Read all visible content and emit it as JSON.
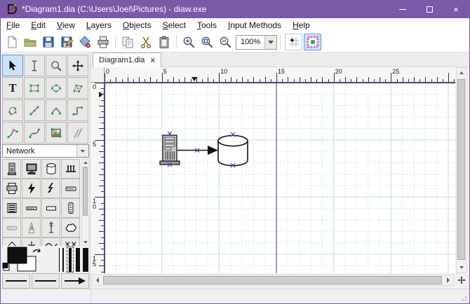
{
  "window": {
    "title": "*Diagram1.dia (C:\\Users\\Joel\\Pictures) - diaw.exe",
    "controls": {
      "close_glyph": "×"
    }
  },
  "menu": {
    "items": [
      "File",
      "Edit",
      "View",
      "Layers",
      "Objects",
      "Select",
      "Tools",
      "Input Methods",
      "Help"
    ]
  },
  "toolbar": {
    "zoom_value": "100%",
    "buttons": [
      "new",
      "open",
      "save",
      "save-as",
      "export",
      "print",
      "copy",
      "cut",
      "paste",
      "zoom-in",
      "zoom-fit",
      "zoom-out",
      "snap-to-grid",
      "snap-to-objects"
    ],
    "snap_to_objects_active": true
  },
  "tab": {
    "label": "Diagram1.dia",
    "close_glyph": "×"
  },
  "toolbox": {
    "selected": "modify",
    "text_glyph": "T",
    "tools": [
      "modify",
      "text-edit",
      "magnify",
      "scroll",
      "text",
      "box",
      "ellipse",
      "polygon",
      "beziergon",
      "line",
      "arc",
      "zigzagline",
      "polyline",
      "bezierline",
      "image",
      "outline"
    ]
  },
  "shape_palette": {
    "category": "Network",
    "shapes": [
      "computer",
      "monitor",
      "storage",
      "hub",
      "printer",
      "flash",
      "lightning",
      "modem",
      "switch",
      "patch-panel",
      "box",
      "modem-vertical",
      "router",
      "radio-tower",
      "antenna",
      "cloud",
      "firewall",
      "ground",
      "wan-link",
      "crossover"
    ]
  },
  "rulers": {
    "horizontal_labels": [
      "0",
      "5",
      "10",
      "15",
      "20",
      "25"
    ],
    "vertical_labels": [
      "0",
      "5",
      "10",
      "15"
    ]
  },
  "canvas": {
    "objects": [
      "computer",
      "connection-arrow",
      "storage-cylinder"
    ]
  },
  "colors": {
    "titlebar": "#7a59a7",
    "selected_tool_bg": "#cde3f7",
    "grid_line": "#cfe8ee",
    "page_boundary": "#5a5aaa",
    "connection_point": "#3d3dd9"
  }
}
